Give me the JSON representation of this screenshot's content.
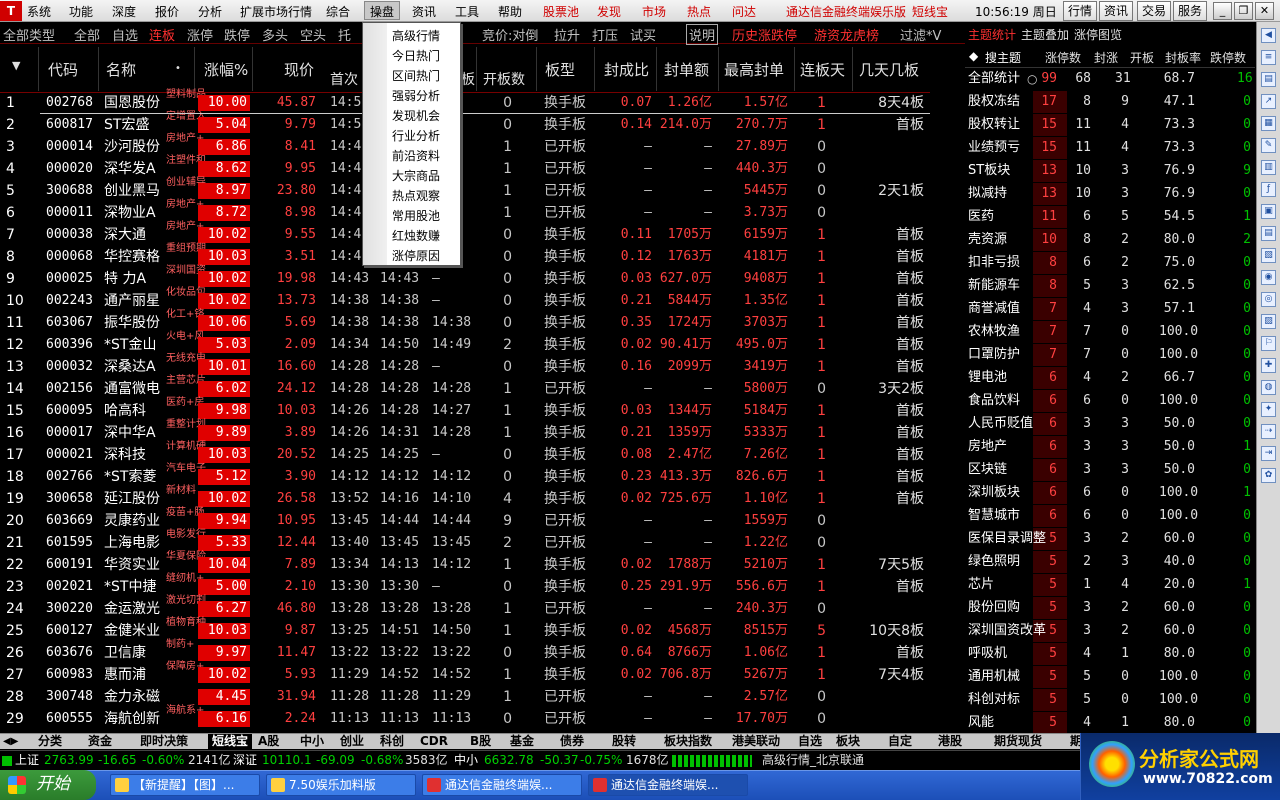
{
  "menu": {
    "items": [
      "系统",
      "功能",
      "深度",
      "报价",
      "分析",
      "扩展市场行情",
      "综合",
      "操盘",
      "资讯",
      "工具",
      "帮助",
      "股票池",
      "发现",
      "市场",
      "热点",
      "问达"
    ],
    "red_items": [
      "股票池",
      "发现",
      "市场",
      "热点",
      "问达"
    ],
    "active": "操盘",
    "app_title": "通达信金融终端娱乐版",
    "short_line": "短线宝",
    "clock": "10:56:19 周日",
    "top_buttons": [
      "行情",
      "资讯",
      "交易",
      "服务"
    ]
  },
  "tabs": {
    "items": [
      "全部类型",
      "全部",
      "自选",
      "连板",
      "涨停",
      "跌停",
      "多头",
      "空头",
      "托",
      "竞价:对倒",
      "拉升",
      "打压",
      "试买",
      "说明",
      "历史涨跌停",
      "游资龙虎榜",
      "过滤*V"
    ],
    "selected": "连板"
  },
  "dropdown": {
    "items": [
      "高级行情",
      "今日热门",
      "区间热门",
      "强弱分析",
      "发现机会",
      "行业分析",
      "前沿资料",
      "大宗商品",
      "热点观察",
      "常用股池",
      "红烛数赚",
      "涨停原因"
    ]
  },
  "table": {
    "headers": {
      "code": "代码",
      "name": "名称",
      "pct": "涨幅%",
      "price": "现价",
      "first": "首次",
      "board_suffix": "板",
      "open_count": "开板数",
      "board_type": "板型",
      "seal_ratio": "封成比",
      "seal_amount": "封单额",
      "max_seal": "最高封单",
      "consec": "连板天",
      "mult": "几天几板"
    },
    "rows": [
      {
        "i": "1",
        "code": "002768",
        "name": "国恩股份",
        "tag": "塑料制品",
        "pct": "10.00",
        "price": "45.87",
        "t1": "14:55",
        "t2": "",
        "t3": "",
        "open": "0",
        "type": "换手板",
        "ratio": "0.07",
        "amt": "1.26亿",
        "max": "1.57亿",
        "days": "1",
        "mult": "8天4板"
      },
      {
        "i": "2",
        "code": "600817",
        "name": "ST宏盛",
        "tag": "定增置入",
        "pct": "5.04",
        "price": "9.79",
        "t1": "14:50",
        "t2": "",
        "t3": "",
        "open": "0",
        "type": "换手板",
        "ratio": "0.14",
        "amt": "214.0万",
        "max": "270.7万",
        "days": "1",
        "mult": "首板"
      },
      {
        "i": "3",
        "code": "000014",
        "name": "沙河股份",
        "tag": "房地产+",
        "pct": "6.86",
        "price": "8.41",
        "t1": "14:48",
        "t2": "",
        "t3": "8",
        "open": "1",
        "type": "已开板",
        "ratio": "–",
        "amt": "–",
        "max": "27.89万",
        "days": "0",
        "mult": ""
      },
      {
        "i": "4",
        "code": "000020",
        "name": "深华发A",
        "tag": "注塑件和",
        "pct": "8.62",
        "price": "9.95",
        "t1": "14:47",
        "t2": "",
        "t3": "9",
        "open": "1",
        "type": "已开板",
        "ratio": "–",
        "amt": "–",
        "max": "440.3万",
        "days": "0",
        "mult": ""
      },
      {
        "i": "5",
        "code": "300688",
        "name": "创业黑马",
        "tag": "创业辅导",
        "pct": "8.97",
        "price": "23.80",
        "t1": "14:47",
        "t2": "",
        "t3": "4",
        "open": "1",
        "type": "已开板",
        "ratio": "–",
        "amt": "–",
        "max": "5445万",
        "days": "0",
        "mult": "2天1板"
      },
      {
        "i": "6",
        "code": "000011",
        "name": "深物业A",
        "tag": "房地产+",
        "pct": "8.72",
        "price": "8.98",
        "t1": "14:46",
        "t2": "",
        "t3": "",
        "open": "1",
        "type": "已开板",
        "ratio": "–",
        "amt": "–",
        "max": "3.73万",
        "days": "0",
        "mult": ""
      },
      {
        "i": "7",
        "code": "000038",
        "name": "深大通",
        "tag": "房地产+",
        "pct": "10.02",
        "price": "9.55",
        "t1": "14:46",
        "t2": "",
        "t3": "",
        "open": "0",
        "type": "换手板",
        "ratio": "0.11",
        "amt": "1705万",
        "max": "6159万",
        "days": "1",
        "mult": "首板"
      },
      {
        "i": "8",
        "code": "000068",
        "name": "华控赛格",
        "tag": "重组预期",
        "pct": "10.03",
        "price": "3.51",
        "t1": "14:45",
        "t2": "",
        "t3": "5",
        "open": "0",
        "type": "换手板",
        "ratio": "0.12",
        "amt": "1763万",
        "max": "4181万",
        "days": "1",
        "mult": "首板"
      },
      {
        "i": "9",
        "code": "000025",
        "name": "特 力A",
        "tag": "深圳国资",
        "pct": "10.02",
        "price": "19.98",
        "t1": "14:43",
        "t2": "14:43",
        "t3": "–",
        "open": "0",
        "type": "换手板",
        "ratio": "0.03",
        "amt": "627.0万",
        "max": "9408万",
        "days": "1",
        "mult": "首板"
      },
      {
        "i": "10",
        "code": "002243",
        "name": "通产丽星",
        "tag": "化妆品包",
        "pct": "10.02",
        "price": "13.73",
        "t1": "14:38",
        "t2": "14:38",
        "t3": "–",
        "open": "0",
        "type": "换手板",
        "ratio": "0.21",
        "amt": "5844万",
        "max": "1.35亿",
        "days": "1",
        "mult": "首板"
      },
      {
        "i": "11",
        "code": "603067",
        "name": "振华股份",
        "tag": "化工+铬",
        "pct": "10.06",
        "price": "5.69",
        "t1": "14:38",
        "t2": "14:38",
        "t3": "14:38",
        "open": "0",
        "type": "换手板",
        "ratio": "0.35",
        "amt": "1724万",
        "max": "3703万",
        "days": "1",
        "mult": "首板"
      },
      {
        "i": "12",
        "code": "600396",
        "name": "*ST金山",
        "tag": "火电+风",
        "pct": "5.03",
        "price": "2.09",
        "t1": "14:34",
        "t2": "14:50",
        "t3": "14:49",
        "open": "2",
        "type": "换手板",
        "ratio": "0.02",
        "amt": "90.41万",
        "max": "495.0万",
        "days": "1",
        "mult": "首板"
      },
      {
        "i": "13",
        "code": "000032",
        "name": "深桑达A",
        "tag": "无线充电",
        "pct": "10.01",
        "price": "16.60",
        "t1": "14:28",
        "t2": "14:28",
        "t3": "–",
        "open": "0",
        "type": "换手板",
        "ratio": "0.16",
        "amt": "2099万",
        "max": "3419万",
        "days": "1",
        "mult": "首板"
      },
      {
        "i": "14",
        "code": "002156",
        "name": "通富微电",
        "tag": "主营芯片",
        "pct": "6.02",
        "price": "24.12",
        "t1": "14:28",
        "t2": "14:28",
        "t3": "14:28",
        "open": "1",
        "type": "已开板",
        "ratio": "–",
        "amt": "–",
        "max": "5800万",
        "days": "0",
        "mult": "3天2板"
      },
      {
        "i": "15",
        "code": "600095",
        "name": "哈高科",
        "tag": "医药+房",
        "pct": "9.98",
        "price": "10.03",
        "t1": "14:26",
        "t2": "14:28",
        "t3": "14:27",
        "open": "1",
        "type": "换手板",
        "ratio": "0.03",
        "amt": "1344万",
        "max": "5184万",
        "days": "1",
        "mult": "首板"
      },
      {
        "i": "16",
        "code": "000017",
        "name": "深中华A",
        "tag": "重整计划",
        "pct": "9.89",
        "price": "3.89",
        "t1": "14:26",
        "t2": "14:31",
        "t3": "14:28",
        "open": "1",
        "type": "换手板",
        "ratio": "0.21",
        "amt": "1359万",
        "max": "5333万",
        "days": "1",
        "mult": "首板"
      },
      {
        "i": "17",
        "code": "000021",
        "name": "深科技",
        "tag": "计算机硬",
        "pct": "10.03",
        "price": "20.52",
        "t1": "14:25",
        "t2": "14:25",
        "t3": "–",
        "open": "0",
        "type": "换手板",
        "ratio": "0.08",
        "amt": "2.47亿",
        "max": "7.26亿",
        "days": "1",
        "mult": "首板"
      },
      {
        "i": "18",
        "code": "002766",
        "name": "*ST索菱",
        "tag": "汽车电子",
        "pct": "5.12",
        "price": "3.90",
        "t1": "14:12",
        "t2": "14:12",
        "t3": "14:12",
        "open": "0",
        "type": "换手板",
        "ratio": "0.23",
        "amt": "413.3万",
        "max": "826.6万",
        "days": "1",
        "mult": "首板"
      },
      {
        "i": "19",
        "code": "300658",
        "name": "延江股份",
        "tag": "新材料",
        "pct": "10.02",
        "price": "26.58",
        "t1": "13:52",
        "t2": "14:16",
        "t3": "14:10",
        "open": "4",
        "type": "换手板",
        "ratio": "0.02",
        "amt": "725.6万",
        "max": "1.10亿",
        "days": "1",
        "mult": "首板"
      },
      {
        "i": "20",
        "code": "603669",
        "name": "灵康药业",
        "tag": "疫苗+肠",
        "pct": "9.94",
        "price": "10.95",
        "t1": "13:45",
        "t2": "14:44",
        "t3": "14:44",
        "open": "9",
        "type": "已开板",
        "ratio": "–",
        "amt": "–",
        "max": "1559万",
        "days": "0",
        "mult": ""
      },
      {
        "i": "21",
        "code": "601595",
        "name": "上海电影",
        "tag": "电影发行",
        "pct": "5.33",
        "price": "12.44",
        "t1": "13:40",
        "t2": "13:45",
        "t3": "13:45",
        "open": "2",
        "type": "已开板",
        "ratio": "–",
        "amt": "–",
        "max": "1.22亿",
        "days": "0",
        "mult": ""
      },
      {
        "i": "22",
        "code": "600191",
        "name": "华资实业",
        "tag": "华夏保险",
        "pct": "10.04",
        "price": "7.89",
        "t1": "13:34",
        "t2": "14:13",
        "t3": "14:12",
        "open": "1",
        "type": "换手板",
        "ratio": "0.02",
        "amt": "1788万",
        "max": "5210万",
        "days": "1",
        "mult": "7天5板"
      },
      {
        "i": "23",
        "code": "002021",
        "name": "*ST中捷",
        "tag": "缝纫机+",
        "pct": "5.00",
        "price": "2.10",
        "t1": "13:30",
        "t2": "13:30",
        "t3": "–",
        "open": "0",
        "type": "换手板",
        "ratio": "0.25",
        "amt": "291.9万",
        "max": "556.6万",
        "days": "1",
        "mult": "首板"
      },
      {
        "i": "24",
        "code": "300220",
        "name": "金运激光",
        "tag": "激光切割",
        "pct": "6.27",
        "price": "46.80",
        "t1": "13:28",
        "t2": "13:28",
        "t3": "13:28",
        "open": "1",
        "type": "已开板",
        "ratio": "–",
        "amt": "–",
        "max": "240.3万",
        "days": "0",
        "mult": ""
      },
      {
        "i": "25",
        "code": "600127",
        "name": "金健米业",
        "tag": "植物育种",
        "pct": "10.03",
        "price": "9.87",
        "t1": "13:25",
        "t2": "14:51",
        "t3": "14:50",
        "open": "1",
        "type": "换手板",
        "ratio": "0.02",
        "amt": "4568万",
        "max": "8515万",
        "days": "5",
        "mult": "10天8板"
      },
      {
        "i": "26",
        "code": "603676",
        "name": "卫信康",
        "tag": "制药+",
        "pct": "9.97",
        "price": "11.47",
        "t1": "13:22",
        "t2": "13:22",
        "t3": "13:22",
        "open": "0",
        "type": "换手板",
        "ratio": "0.64",
        "amt": "8766万",
        "max": "1.06亿",
        "days": "1",
        "mult": "首板"
      },
      {
        "i": "27",
        "code": "600983",
        "name": "惠而浦",
        "tag": "保障房+",
        "pct": "10.02",
        "price": "5.93",
        "t1": "11:29",
        "t2": "14:52",
        "t3": "14:52",
        "open": "1",
        "type": "换手板",
        "ratio": "0.02",
        "amt": "706.8万",
        "max": "5267万",
        "days": "1",
        "mult": "7天4板"
      },
      {
        "i": "28",
        "code": "300748",
        "name": "金力永磁",
        "tag": "",
        "pct": "4.45",
        "price": "31.94",
        "t1": "11:28",
        "t2": "11:28",
        "t3": "11:29",
        "open": "1",
        "type": "已开板",
        "ratio": "–",
        "amt": "–",
        "max": "2.57亿",
        "days": "0",
        "mult": ""
      },
      {
        "i": "29",
        "code": "600555",
        "name": "海航创新",
        "tag": "海航系+",
        "pct": "6.16",
        "price": "2.24",
        "t1": "11:13",
        "t2": "11:13",
        "t3": "11:13",
        "open": "0",
        "type": "已开板",
        "ratio": "–",
        "amt": "–",
        "max": "17.70万",
        "days": "0",
        "mult": ""
      }
    ]
  },
  "right_panel": {
    "top_tabs": [
      "主题统计",
      "主题叠加",
      "涨停图览"
    ],
    "headers": [
      "搜主题",
      "涨停数",
      "封涨",
      "开板",
      "封板率",
      "跌停数"
    ],
    "summary": {
      "name": "全部统计",
      "a": "99",
      "b": "68",
      "c": "31",
      "d": "68.7",
      "e": "16"
    },
    "rows": [
      {
        "name": "股权冻结",
        "a": "17",
        "b": "8",
        "c": "9",
        "d": "47.1",
        "e": "0"
      },
      {
        "name": "股权转让",
        "a": "15",
        "b": "11",
        "c": "4",
        "d": "73.3",
        "e": "0"
      },
      {
        "name": "业绩预亏",
        "a": "15",
        "b": "11",
        "c": "4",
        "d": "73.3",
        "e": "0"
      },
      {
        "name": "ST板块",
        "a": "13",
        "b": "10",
        "c": "3",
        "d": "76.9",
        "e": "9"
      },
      {
        "name": "拟减持",
        "a": "13",
        "b": "10",
        "c": "3",
        "d": "76.9",
        "e": "0"
      },
      {
        "name": "医药",
        "a": "11",
        "b": "6",
        "c": "5",
        "d": "54.5",
        "e": "1"
      },
      {
        "name": "壳资源",
        "a": "10",
        "b": "8",
        "c": "2",
        "d": "80.0",
        "e": "2"
      },
      {
        "name": "扣非亏损",
        "a": "8",
        "b": "6",
        "c": "2",
        "d": "75.0",
        "e": "0"
      },
      {
        "name": "新能源车",
        "a": "8",
        "b": "5",
        "c": "3",
        "d": "62.5",
        "e": "0"
      },
      {
        "name": "商誉减值",
        "a": "7",
        "b": "4",
        "c": "3",
        "d": "57.1",
        "e": "0"
      },
      {
        "name": "农林牧渔",
        "a": "7",
        "b": "7",
        "c": "0",
        "d": "100.0",
        "e": "0"
      },
      {
        "name": "口罩防护",
        "a": "7",
        "b": "7",
        "c": "0",
        "d": "100.0",
        "e": "0"
      },
      {
        "name": "锂电池",
        "a": "6",
        "b": "4",
        "c": "2",
        "d": "66.7",
        "e": "0"
      },
      {
        "name": "食品饮料",
        "a": "6",
        "b": "6",
        "c": "0",
        "d": "100.0",
        "e": "0"
      },
      {
        "name": "人民币贬值",
        "a": "6",
        "b": "3",
        "c": "3",
        "d": "50.0",
        "e": "0"
      },
      {
        "name": "房地产",
        "a": "6",
        "b": "3",
        "c": "3",
        "d": "50.0",
        "e": "1"
      },
      {
        "name": "区块链",
        "a": "6",
        "b": "3",
        "c": "3",
        "d": "50.0",
        "e": "0"
      },
      {
        "name": "深圳板块",
        "a": "6",
        "b": "6",
        "c": "0",
        "d": "100.0",
        "e": "1"
      },
      {
        "name": "智慧城市",
        "a": "6",
        "b": "6",
        "c": "0",
        "d": "100.0",
        "e": "0"
      },
      {
        "name": "医保目录调整",
        "a": "5",
        "b": "3",
        "c": "2",
        "d": "60.0",
        "e": "0"
      },
      {
        "name": "绿色照明",
        "a": "5",
        "b": "2",
        "c": "3",
        "d": "40.0",
        "e": "0"
      },
      {
        "name": "芯片",
        "a": "5",
        "b": "1",
        "c": "4",
        "d": "20.0",
        "e": "1"
      },
      {
        "name": "股份回购",
        "a": "5",
        "b": "3",
        "c": "2",
        "d": "60.0",
        "e": "0"
      },
      {
        "name": "深圳国资改革",
        "a": "5",
        "b": "3",
        "c": "2",
        "d": "60.0",
        "e": "0"
      },
      {
        "name": "呼吸机",
        "a": "5",
        "b": "4",
        "c": "1",
        "d": "80.0",
        "e": "0"
      },
      {
        "name": "通用机械",
        "a": "5",
        "b": "5",
        "c": "0",
        "d": "100.0",
        "e": "0"
      },
      {
        "name": "科创对标",
        "a": "5",
        "b": "5",
        "c": "0",
        "d": "100.0",
        "e": "0"
      },
      {
        "name": "风能",
        "a": "5",
        "b": "4",
        "c": "1",
        "d": "80.0",
        "e": "0"
      }
    ]
  },
  "bottom_tabs": [
    "分类",
    "资金",
    "即时决策",
    "短线宝",
    "A股",
    "中小",
    "创业",
    "科创",
    "CDR",
    "B股",
    "基金",
    "债券",
    "股转",
    "板块指数",
    "港美联动",
    "自选",
    "板块",
    "自定",
    "港股",
    "期货现货",
    "期权",
    "基金理财"
  ],
  "bottom_selected": "短线宝",
  "status": {
    "sh": "上证",
    "sh_val": "2763.99",
    "sh_chg": "-16.65",
    "sh_pct": "-0.60%",
    "sh_amt": "2141亿",
    "sz": "深证",
    "sz_val": "10110.1",
    "sz_chg": "-69.09",
    "sz_pct": "-0.68%",
    "sz_amt": "3583亿",
    "zx": "中小",
    "zx_val": "6632.78",
    "zx_chg": "-50.37",
    "zx_pct": "-0.75%",
    "zx_amt": "1678亿",
    "right": "高级行情_北京联通"
  },
  "taskbar": {
    "start": "开始",
    "tasks": [
      "【新提醒】【图】...",
      "7.50娱乐加料版",
      "通达信金融终端娱...",
      "通达信金融终端娱..."
    ]
  },
  "watermark": {
    "line1": "分析家公式网",
    "line2": "www.70822.com"
  }
}
